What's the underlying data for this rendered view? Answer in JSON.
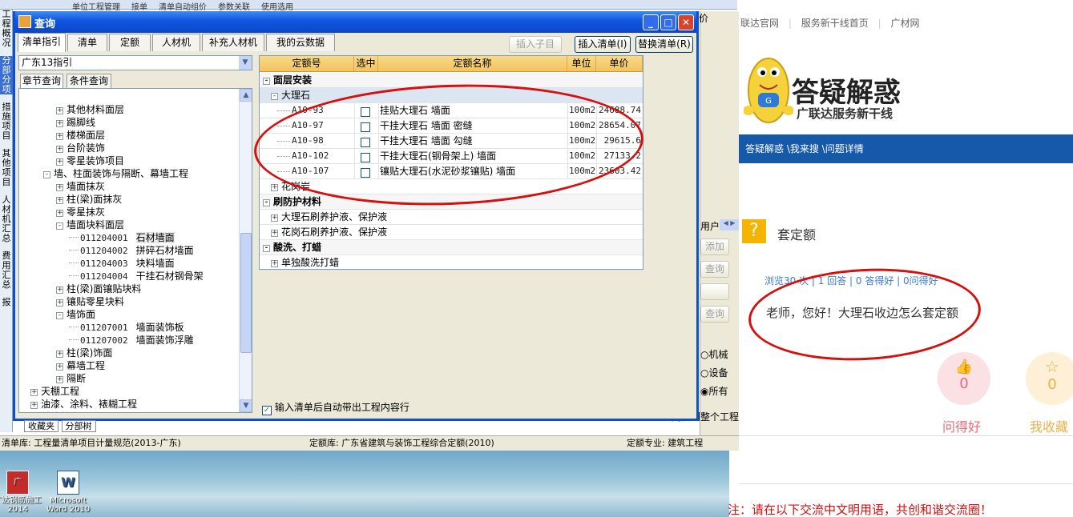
{
  "app": {
    "window_title": "查询"
  },
  "top_toolbar": {
    "items": [
      "单位工程管理",
      "接单",
      "清单自动组价",
      "参数关联",
      "使用选用"
    ]
  },
  "left_strip": {
    "items": [
      "工程概况",
      "分部分项",
      "措施项目",
      "其他项目",
      "人材机汇总",
      "费用汇总",
      "报"
    ]
  },
  "tabs": [
    "清单指引",
    "清单",
    "定额",
    "人材机",
    "补充人材机",
    "我的云数据"
  ],
  "buttons": {
    "insert_child": "插入子目",
    "insert_list": "插入清单(I)",
    "replace_list": "替换清单(R)"
  },
  "combo": {
    "value": "广东13指引"
  },
  "subtabs": [
    "章节查询",
    "条件查询"
  ],
  "tree": [
    {
      "indent": 1,
      "toggle": "+",
      "text": "其他材料面层"
    },
    {
      "indent": 1,
      "toggle": "+",
      "text": "踢脚线"
    },
    {
      "indent": 1,
      "toggle": "+",
      "text": "楼梯面层"
    },
    {
      "indent": 1,
      "toggle": "+",
      "text": "台阶装饰"
    },
    {
      "indent": 1,
      "toggle": "+",
      "text": "零星装饰项目"
    },
    {
      "indent": 0,
      "toggle": "-",
      "text": "墙、柱面装饰与隔断、幕墙工程"
    },
    {
      "indent": 1,
      "toggle": "+",
      "text": "墙面抹灰"
    },
    {
      "indent": 1,
      "toggle": "+",
      "text": "柱(梁)面抹灰"
    },
    {
      "indent": 1,
      "toggle": "+",
      "text": "零星抹灰"
    },
    {
      "indent": 1,
      "toggle": "-",
      "text": "墙面块料面层"
    },
    {
      "indent": 2,
      "toggle": "",
      "code": "011204001",
      "text": "石材墙面",
      "selected": true
    },
    {
      "indent": 2,
      "toggle": "",
      "code": "011204002",
      "text": "拼碎石材墙面"
    },
    {
      "indent": 2,
      "toggle": "",
      "code": "011204003",
      "text": "块料墙面"
    },
    {
      "indent": 2,
      "toggle": "",
      "code": "011204004",
      "text": "干挂石材钢骨架"
    },
    {
      "indent": 1,
      "toggle": "+",
      "text": "柱(梁)面镶贴块料"
    },
    {
      "indent": 1,
      "toggle": "+",
      "text": "镶贴零星块料"
    },
    {
      "indent": 1,
      "toggle": "-",
      "text": "墙饰面"
    },
    {
      "indent": 2,
      "toggle": "",
      "code": "011207001",
      "text": "墙面装饰板"
    },
    {
      "indent": 2,
      "toggle": "",
      "code": "011207002",
      "text": "墙面装饰浮雕"
    },
    {
      "indent": 1,
      "toggle": "+",
      "text": "柱(梁)饰面"
    },
    {
      "indent": 1,
      "toggle": "+",
      "text": "幕墙工程"
    },
    {
      "indent": 1,
      "toggle": "+",
      "text": "隔断"
    },
    {
      "indent": -1,
      "toggle": "+",
      "text": "天棚工程"
    },
    {
      "indent": -1,
      "toggle": "+",
      "text": "油漆、涂料、裱糊工程"
    },
    {
      "indent": -1,
      "toggle": "+",
      "text": "其他装饰工程"
    }
  ],
  "grid": {
    "headers": [
      "定额号",
      "选中",
      "定额名称",
      "单位",
      "单价"
    ],
    "rows": [
      {
        "type": "group",
        "toggle": "-",
        "text": "面层安装"
      },
      {
        "type": "subgroup",
        "toggle": "-",
        "text": "大理石"
      },
      {
        "type": "item",
        "code": "A10-93",
        "name": "挂贴大理石 墙面",
        "unit": "100m2",
        "price": "24688.74"
      },
      {
        "type": "item",
        "code": "A10-97",
        "name": "干挂大理石 墙面 密缝",
        "unit": "100m2",
        "price": "28654.07"
      },
      {
        "type": "item",
        "code": "A10-98",
        "name": "干挂大理石 墙面 勾缝",
        "unit": "100m2",
        "price": "29615.6"
      },
      {
        "type": "item",
        "code": "A10-102",
        "name": "干挂大理石(钢骨架上) 墙面",
        "unit": "100m2",
        "price": "27133.2"
      },
      {
        "type": "item",
        "code": "A10-107",
        "name": "镶贴大理石(水泥砂浆镶贴) 墙面",
        "unit": "100m2",
        "price": "23603.42"
      },
      {
        "type": "subgroup2",
        "toggle": "+",
        "text": "花岗岩"
      },
      {
        "type": "group",
        "toggle": "-",
        "text": "刷防护材料"
      },
      {
        "type": "subgroup2",
        "toggle": "+",
        "text": "大理石刷养护液、保护液"
      },
      {
        "type": "subgroup2",
        "toggle": "+",
        "text": "花岗石刷养护液、保护液"
      },
      {
        "type": "group",
        "toggle": "-",
        "text": "酸洗、打蜡"
      },
      {
        "type": "subgroup2",
        "toggle": "+",
        "text": "单独酸洗打蜡"
      }
    ]
  },
  "auto_option": {
    "label": "输入清单后自动带出工程内容行",
    "checked": true
  },
  "bottom_tabs": [
    "收藏夹",
    "分部树"
  ],
  "statusbar": {
    "list_lib": "清单库: 工程量清单项目计量规范(2013-广东)",
    "quota_lib": "定额库: 广东省建筑与装饰工程综合定额(2010)",
    "quota_major": "定额专业: 建筑工程"
  },
  "side_panel": {
    "tab_hint": "用户",
    "buttons": [
      "添加",
      "查询",
      "查询"
    ],
    "radios": [
      {
        "label": "机械",
        "checked": false
      },
      {
        "label": "设备",
        "checked": false
      },
      {
        "label": "所有",
        "checked": true
      }
    ],
    "sync": "同步到整个工程"
  },
  "desktop_icons": [
    {
      "label": "广达钢筋施工 2014",
      "text": "广达钢筋施工2014"
    },
    {
      "label": "Microsoft Word 2010",
      "text": "Microsoft Word 2010"
    }
  ],
  "web": {
    "top_hint": "价",
    "nav_links": [
      "联达官网",
      "服务新干线首页",
      "广材网"
    ],
    "logo_title": "答疑解惑",
    "logo_sub": "广联达服务新干线",
    "breadcrumb": "答疑解惑 \\我来搜 \\问题详情",
    "question_title": "套定额",
    "stats": "浏览30 次 | 1 回答 | 0 答得好 | 0问得好",
    "question_text": "老师，您好！大理石收边怎么套定额",
    "like": {
      "count": "0",
      "label": "问得好"
    },
    "fav": {
      "count": "0",
      "label": "我收藏"
    },
    "notice": "注：请在以下交流中文明用语，共创和谐交流圈！",
    "colors": {
      "bar": "#1659a8",
      "red": "#d60f0f",
      "pink": "#fbe0e4",
      "gold": "#fdf0d6"
    }
  }
}
